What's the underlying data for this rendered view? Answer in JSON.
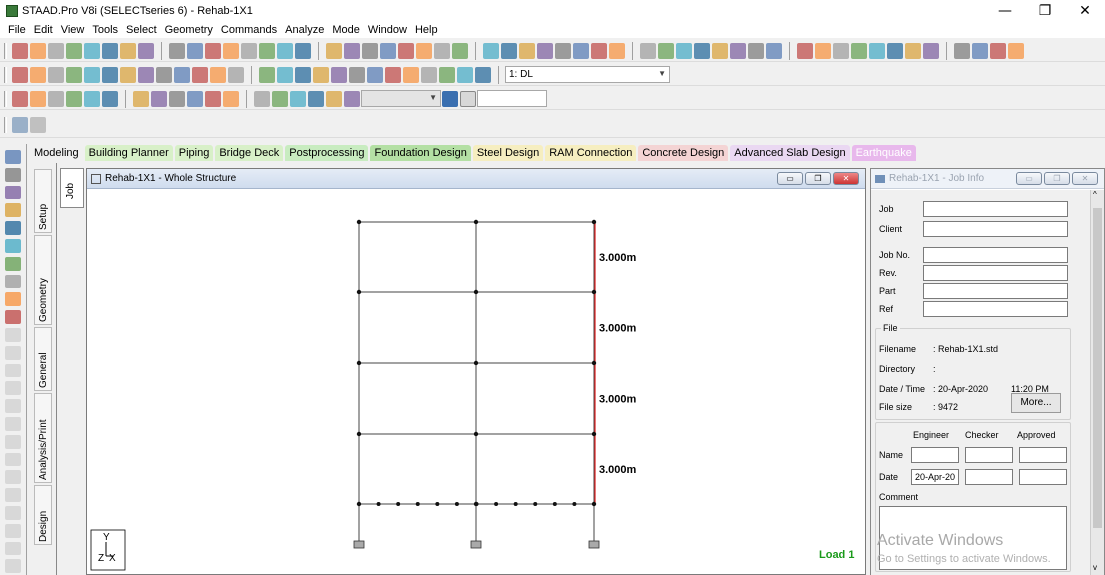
{
  "window": {
    "title": "STAAD.Pro V8i (SELECTseries 6) - Rehab-1X1",
    "minimize": "—",
    "maximize": "❐",
    "close": "✕"
  },
  "menu": [
    "File",
    "Edit",
    "View",
    "Tools",
    "Select",
    "Geometry",
    "Commands",
    "Analyze",
    "Mode",
    "Window",
    "Help"
  ],
  "toolbar3": {
    "load_combo": "1: DL"
  },
  "tabs": [
    {
      "label": "Modeling",
      "color": "#f0f0f0"
    },
    {
      "label": "Building Planner",
      "color": "#d8f0c8"
    },
    {
      "label": "Piping",
      "color": "#d8f0c8"
    },
    {
      "label": "Bridge Deck",
      "color": "#d8f0c8"
    },
    {
      "label": "Postprocessing",
      "color": "#c8ecc0"
    },
    {
      "label": "Foundation Design",
      "color": "#b4e0a4"
    },
    {
      "label": "Steel Design",
      "color": "#f6eec0"
    },
    {
      "label": "RAM Connection",
      "color": "#f6eec0"
    },
    {
      "label": "Concrete Design",
      "color": "#f4d4d4"
    },
    {
      "label": "Advanced Slab Design",
      "color": "#ead8f2"
    },
    {
      "label": "Earthquake",
      "color": "#e8b8ec"
    }
  ],
  "side_tabs": {
    "setup": "Setup",
    "job": "Job",
    "geometry": "Geometry",
    "general": "General",
    "analysis": "Analysis/Print",
    "design": "Design"
  },
  "viewport": {
    "title": "Rehab-1X1 - Whole Structure",
    "load_label": "Load 1",
    "axis_y": "Y",
    "axis_z": "Z",
    "axis_x": "X",
    "dims": [
      "3.000m",
      "3.000m",
      "3.000m",
      "3.000m"
    ]
  },
  "job_info": {
    "title": "Rehab-1X1 - Job Info",
    "labels": {
      "job": "Job",
      "client": "Client",
      "job_no": "Job No.",
      "rev": "Rev.",
      "part": "Part",
      "ref": "Ref",
      "file": "File",
      "filename": "Filename",
      "directory": "Directory",
      "datetime": "Date / Time",
      "filesize": "File size",
      "engineer": "Engineer",
      "checker": "Checker",
      "approved": "Approved",
      "name": "Name",
      "date": "Date",
      "comment": "Comment"
    },
    "values": {
      "filename": ": Rehab-1X1.std",
      "directory": ":",
      "datetime": ": 20-Apr-2020",
      "time": "11:20 PM",
      "filesize": ": 9472",
      "date_engineer": "20-Apr-20"
    },
    "more_button": "More..."
  },
  "watermark": {
    "line1": "Activate Windows",
    "line2": "Go to Settings to activate Windows."
  }
}
